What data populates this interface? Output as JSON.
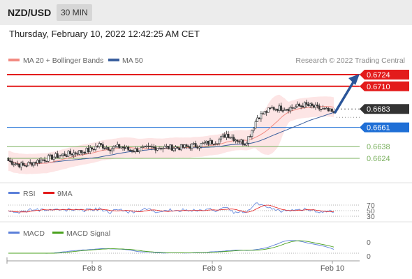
{
  "header": {
    "pair": "NZD/USD",
    "timeframe": "30 MIN"
  },
  "date_line": "Thursday, February 10, 2022 12:42:25 AM CET",
  "watermark": "Research © 2022 Trading Central",
  "colors": {
    "resistance": "#e31b1b",
    "support": "#7ab05e",
    "pivot": "#1f6fd6",
    "price": "#333333",
    "ma20": "#f28b82",
    "ma50": "#3a5f9e",
    "band_fill": "#fcdede",
    "arrow": "#2a5599"
  },
  "chart_data": {
    "type": "candlestick",
    "legend": [
      {
        "label": "MA 20 + Bollinger Bands",
        "color": "#f28b82"
      },
      {
        "label": "MA 50",
        "color": "#3a5f9e"
      }
    ],
    "levels": [
      {
        "value": 0.6724,
        "label": "0.6724",
        "kind": "resistance"
      },
      {
        "value": 0.671,
        "label": "0.6710",
        "kind": "resistance"
      },
      {
        "value": 0.6683,
        "label": "0.6683",
        "kind": "price"
      },
      {
        "value": 0.6661,
        "label": "0.6661",
        "kind": "pivot"
      },
      {
        "value": 0.6638,
        "label": "0.6638",
        "kind": "support"
      },
      {
        "value": 0.6624,
        "label": "0.6624",
        "kind": "support"
      }
    ],
    "x_ticks": [
      "Feb 8",
      "Feb 9",
      "Feb 10"
    ],
    "ylim": [
      0.6605,
      0.673
    ],
    "last_close": 0.6679,
    "target": 0.6724,
    "close_path": [
      [
        0,
        0.6621
      ],
      [
        8,
        0.6615
      ],
      [
        15,
        0.662
      ],
      [
        25,
        0.6626
      ],
      [
        35,
        0.663
      ],
      [
        45,
        0.6634
      ],
      [
        50,
        0.664
      ],
      [
        56,
        0.6636
      ],
      [
        62,
        0.6638
      ],
      [
        66,
        0.6634
      ],
      [
        70,
        0.6634
      ],
      [
        80,
        0.6637
      ],
      [
        95,
        0.6637
      ],
      [
        105,
        0.664
      ],
      [
        115,
        0.6645
      ],
      [
        120,
        0.6653
      ],
      [
        124,
        0.6648
      ],
      [
        130,
        0.6642
      ],
      [
        133,
        0.6653
      ],
      [
        137,
        0.6673
      ],
      [
        145,
        0.6684
      ],
      [
        155,
        0.6684
      ],
      [
        163,
        0.6688
      ],
      [
        170,
        0.6684
      ],
      [
        175,
        0.6681
      ],
      [
        178,
        0.6679
      ]
    ],
    "rsi": {
      "legend": [
        {
          "label": "RSI",
          "color": "#5b7fd9"
        },
        {
          "label": "9MA",
          "color": "#e31b1b"
        }
      ],
      "levels": [
        70,
        50,
        30
      ],
      "level_labels": [
        "70",
        "50",
        "30"
      ]
    },
    "macd": {
      "legend": [
        {
          "label": "MACD",
          "color": "#5b7fd9"
        },
        {
          "label": "MACD Signal",
          "color": "#4aa11e"
        }
      ],
      "axis_labels": [
        "0",
        "0"
      ]
    }
  }
}
